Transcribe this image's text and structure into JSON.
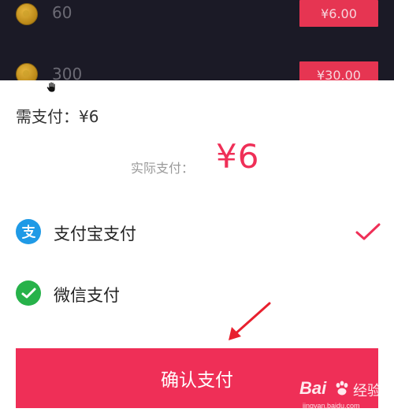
{
  "coin_list": [
    {
      "amount": "60",
      "price": "¥6.00"
    },
    {
      "amount": "300",
      "price": "¥30.00"
    }
  ],
  "payment_sheet": {
    "need_pay": "需支付：¥6",
    "actual_label": "实际支付：",
    "actual_value": "¥6",
    "methods": [
      {
        "label": "支付宝支付",
        "icon": "alipay-icon",
        "selected": true
      },
      {
        "label": "微信支付",
        "icon": "wechat-pay-icon",
        "selected": false
      }
    ],
    "confirm_label": "确认支付"
  },
  "watermark": {
    "logo": "Bai",
    "suffix": "经验",
    "url": "jingyan.baidu.com"
  },
  "colors": {
    "accent": "#ef2f57",
    "top_background": "#1b1a26",
    "alipay_blue": "#1f9ae6",
    "wechat_green": "#27b24a"
  }
}
